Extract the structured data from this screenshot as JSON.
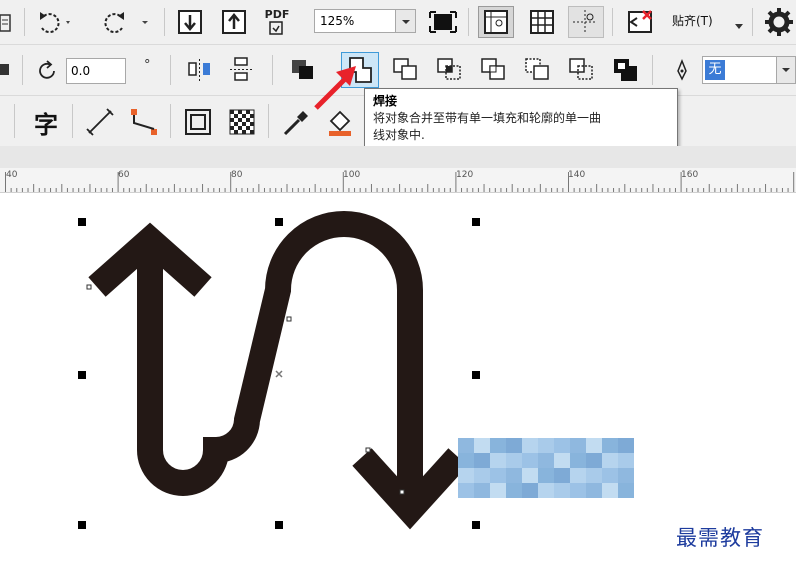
{
  "toolbar_top": {
    "pdf_label": "PDF",
    "zoom_value": "125%",
    "snap_label": "贴齐(T)"
  },
  "toolbar_property": {
    "rotation_value": "0.0",
    "degree_symbol": "°",
    "fill_value": "无"
  },
  "tooltip": {
    "title": "焊接",
    "description_line1": "将对象合并至带有单一填充和轮廓的单一曲",
    "description_line2": "线对象中."
  },
  "ruler": {
    "labels": [
      "40",
      "60",
      "80",
      "100",
      "120",
      "140",
      "160"
    ]
  },
  "toolbar_tools": {
    "text_tool_glyph": "字"
  },
  "watermark": "最需教育",
  "colors": {
    "accent_blue": "#3f9ad8",
    "arrow_red": "#e8222b",
    "shape_fill": "#231815"
  }
}
